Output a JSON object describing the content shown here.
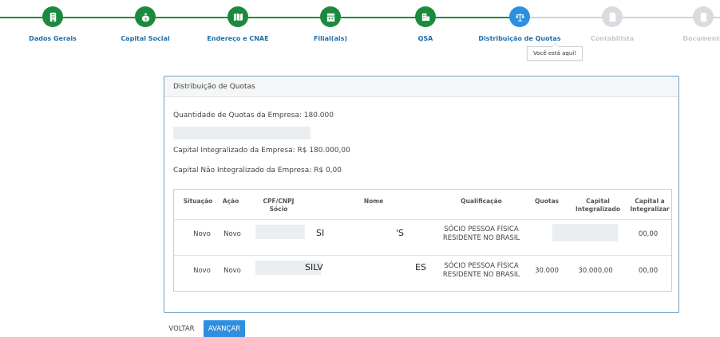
{
  "stepper": {
    "steps": [
      {
        "label": "Dados Gerais",
        "state": "done",
        "icon": "building-icon"
      },
      {
        "label": "Capital Social",
        "state": "done",
        "icon": "money-bag-icon"
      },
      {
        "label": "Endereço e CNAE",
        "state": "done",
        "icon": "map-icon"
      },
      {
        "label": "Filial(ais)",
        "state": "done",
        "icon": "store-icon"
      },
      {
        "label": "QSA",
        "state": "done",
        "icon": "people-icon"
      },
      {
        "label": "Distribuição de Quotas",
        "state": "current",
        "icon": "scale-icon"
      },
      {
        "label": "Contabilista",
        "state": "todo",
        "icon": "document-icon"
      },
      {
        "label": "Documento",
        "state": "todo",
        "icon": "document-icon"
      }
    ],
    "tooltip": "Você está aqui!"
  },
  "panel": {
    "title": "Distribuição de Quotas",
    "quantidade_quotas": "Quantidade de Quotas da Empresa: 180.000",
    "capital_integralizado": "Capital Integralizado da Empresa: R$ 180.000,00",
    "capital_nao_integralizado": "Capital Não Integralizado da Empresa: R$ 0,00"
  },
  "table": {
    "headers": {
      "situacao": "Situação",
      "acao": "Ação",
      "cpf_line1": "CPF/CNPJ",
      "cpf_line2": "Sócio",
      "nome": "Nome",
      "qualificacao": "Qualificação",
      "quotas": "Quotas",
      "capital_int_line1": "Capital",
      "capital_int_line2": "Integralizado",
      "capital_a_line1": "Capital a",
      "capital_a_line2": "Integralizar"
    },
    "rows": [
      {
        "situacao": "Novo",
        "acao": "Novo",
        "nome_start": "SI",
        "nome_end": "'S",
        "qualificacao_line1": "SÓCIO PESSOA FÍSICA",
        "qualificacao_line2": "RESIDENTE NO BRASIL",
        "quotas": "",
        "capital_integralizado": "",
        "capital_a_integralizar": "00,00"
      },
      {
        "situacao": "Novo",
        "acao": "Novo",
        "nome_start": "SILV",
        "nome_end": "ES",
        "qualificacao_line1": "SÓCIO PESSOA FÍSICA",
        "qualificacao_line2": "RESIDENTE NO BRASIL",
        "quotas": "30.000",
        "capital_integralizado": "30.000,00",
        "capital_a_integralizar": "00,00"
      }
    ]
  },
  "buttons": {
    "voltar": "VOLTAR",
    "avancar": "AVANÇAR"
  },
  "colors": {
    "done": "#1b8a3e",
    "current": "#2d8fe0",
    "todo": "#d9dcdf",
    "link": "#1e6ea8"
  }
}
